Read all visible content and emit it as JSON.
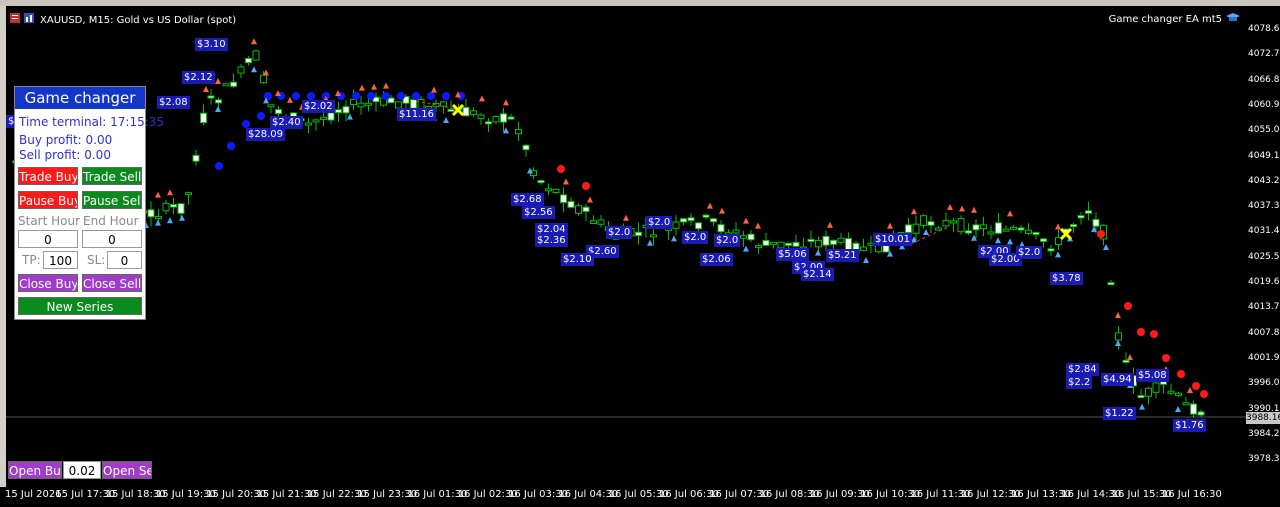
{
  "header": {
    "symbol": "XAUUSD, M15:  Gold vs US Dollar (spot)",
    "ea_name": "Game changer EA mt5"
  },
  "price_axis": [
    "4078.60",
    "4072.70",
    "4066.80",
    "4060.90",
    "4055.00",
    "4049.10",
    "4043.20",
    "4037.30",
    "4031.40",
    "4025.50",
    "4019.60",
    "4013.70",
    "4007.80",
    "4001.90",
    "3996.00",
    "3990.10",
    "3984.20",
    "3978.30"
  ],
  "current_price": "3988.16",
  "time_axis": [
    "15 Jul 2026",
    "15 Jul 17:30",
    "15 Jul 18:30",
    "15 Jul 19:30",
    "15 Jul 20:30",
    "15 Jul 21:30",
    "15 Jul 22:30",
    "15 Jul 23:30",
    "16 Jul 01:30",
    "16 Jul 02:30",
    "16 Jul 03:30",
    "16 Jul 04:30",
    "16 Jul 05:30",
    "16 Jul 06:30",
    "16 Jul 07:30",
    "16 Jul 08:30",
    "16 Jul 09:30",
    "16 Jul 10:30",
    "16 Jul 11:30",
    "16 Jul 12:30",
    "16 Jul 13:30",
    "16 Jul 14:30",
    "16 Jul 15:30",
    "16 Jul 16:30"
  ],
  "panel": {
    "title": "Game changer",
    "terminal": "Time terminal: 17:15:35",
    "buy_profit": "Buy profit: 0.00",
    "sell_profit": "Sell profit: 0.00",
    "trade_buy": "Trade Buy",
    "trade_sell": "Trade Sell",
    "pause_buy": "Pause Buy",
    "pause_sell": "Pause Sell",
    "start_hour_label": "Start Hour",
    "end_hour_label": "End Hour",
    "start_hour": "0",
    "end_hour": "0",
    "tp_label": "TP:",
    "tp_value": "100",
    "sl_label": "SL:",
    "sl_value": "0",
    "close_buy": "Close Buy",
    "close_sell": "Close Sell",
    "new_series": "New Series"
  },
  "open_bar": {
    "open_buy": "Open Buy",
    "lot": "0.02",
    "open_sell": "Open Sell"
  },
  "profit_tags": [
    {
      "t": "$3.10"
    },
    {
      "t": "$2.12"
    },
    {
      "t": "$2.02"
    },
    {
      "t": "$2.44"
    },
    {
      "t": "$2.08"
    },
    {
      "t": "$28.09"
    },
    {
      "t": "$2.40"
    },
    {
      "t": "$2.02"
    },
    {
      "t": "$11.16"
    },
    {
      "t": "$2.02"
    },
    {
      "t": "$2.04"
    },
    {
      "t": "$2.68"
    },
    {
      "t": "$2.56"
    },
    {
      "t": "$2.04"
    },
    {
      "t": "$2.36"
    },
    {
      "t": "$2.60"
    },
    {
      "t": "$2.10"
    },
    {
      "t": "$2.0"
    },
    {
      "t": "$2.0"
    },
    {
      "t": "$2.0"
    },
    {
      "t": "$2.06"
    },
    {
      "t": "$2.0"
    },
    {
      "t": "$5.06"
    },
    {
      "t": "$2.00"
    },
    {
      "t": "$2.14"
    },
    {
      "t": "$5.21"
    },
    {
      "t": "$10.01"
    },
    {
      "t": "$2.00"
    },
    {
      "t": "$2.00"
    },
    {
      "t": "$2.0"
    },
    {
      "t": "$3.78"
    },
    {
      "t": "$2.84"
    },
    {
      "t": "$2.2"
    },
    {
      "t": "$4.94"
    },
    {
      "t": "$5.08"
    },
    {
      "t": "$1.22"
    },
    {
      "t": "$1.76"
    }
  ]
}
